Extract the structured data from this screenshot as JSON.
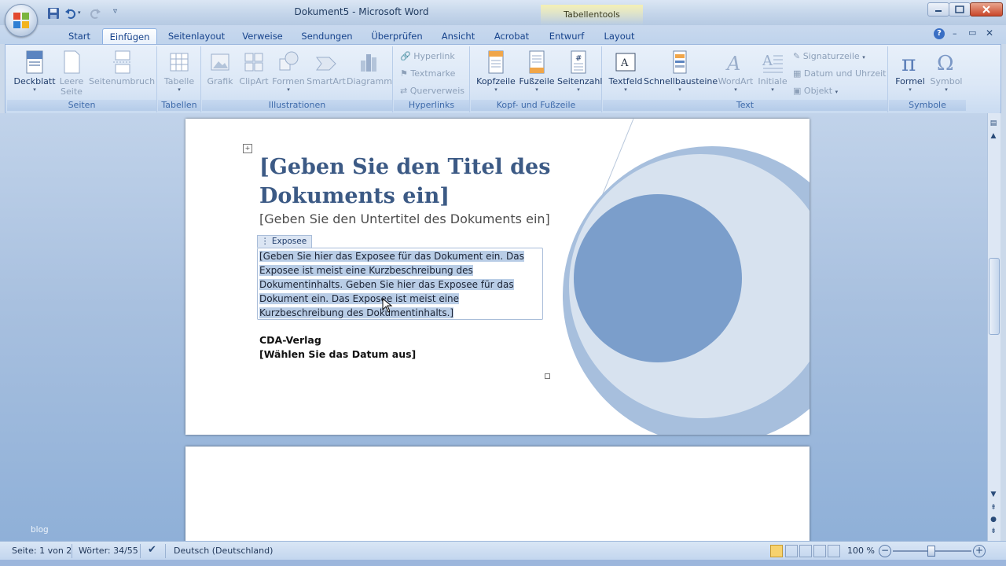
{
  "window": {
    "title": "Dokument5 - Microsoft Word",
    "contextual_tab_group": "Tabellentools"
  },
  "tabs": [
    "Start",
    "Einfügen",
    "Seitenlayout",
    "Verweise",
    "Sendungen",
    "Überprüfen",
    "Ansicht",
    "Acrobat",
    "Entwurf",
    "Layout"
  ],
  "active_tab": "Einfügen",
  "ribbon": {
    "seiten": {
      "label": "Seiten",
      "deckblatt": "Deckblatt",
      "leere_seite_1": "Leere",
      "leere_seite_2": "Seite",
      "seitenumbruch": "Seitenumbruch"
    },
    "tabellen": {
      "label": "Tabellen",
      "tabelle": "Tabelle"
    },
    "illustrationen": {
      "label": "Illustrationen",
      "grafik": "Grafik",
      "clipart": "ClipArt",
      "formen": "Formen",
      "smartart": "SmartArt",
      "diagramm": "Diagramm"
    },
    "hyperlinks": {
      "label": "Hyperlinks",
      "hyperlink": "Hyperlink",
      "textmarke": "Textmarke",
      "querverweis": "Querverweis"
    },
    "kopf_fuss": {
      "label": "Kopf- und Fußzeile",
      "kopfzeile": "Kopfzeile",
      "fusszeile": "Fußzeile",
      "seitenzahl": "Seitenzahl"
    },
    "text": {
      "label": "Text",
      "textfeld": "Textfeld",
      "schnellbausteine": "Schnellbausteine",
      "wordart": "WordArt",
      "initiale": "Initiale",
      "signaturzeile": "Signaturzeile",
      "datum": "Datum und Uhrzeit",
      "objekt": "Objekt"
    },
    "symbole": {
      "label": "Symbole",
      "formel": "Formel",
      "symbol": "Symbol"
    }
  },
  "document": {
    "title_line1": "[Geben Sie den Titel des",
    "title_line2": "Dokuments ein]",
    "subtitle": "[Geben Sie den Untertitel des Dokuments ein]",
    "abstract_tag": "Exposee",
    "abstract_lines": [
      "[Geben Sie hier das Exposee für das Dokument ein. Das",
      "Exposee ist meist eine Kurzbeschreibung des",
      "Dokumentinhalts. Geben Sie hier das Exposee für das",
      "Dokument ein. Das Exposee ist meist eine",
      "Kurzbeschreibung des Dokumentinhalts.]"
    ],
    "company": "CDA-Verlag",
    "date_placeholder": "[Wählen Sie das Datum aus]"
  },
  "statusbar": {
    "page": "Seite: 1 von 2",
    "words": "Wörter: 34/55",
    "language": "Deutsch (Deutschland)",
    "zoom": "100 %"
  },
  "watermark": "blog",
  "colors": {
    "title_blue": "#3c5a85",
    "circle_dark": "#7b9ecb",
    "circle_mid": "#a7bfdd",
    "circle_light": "#d7e2ef"
  }
}
